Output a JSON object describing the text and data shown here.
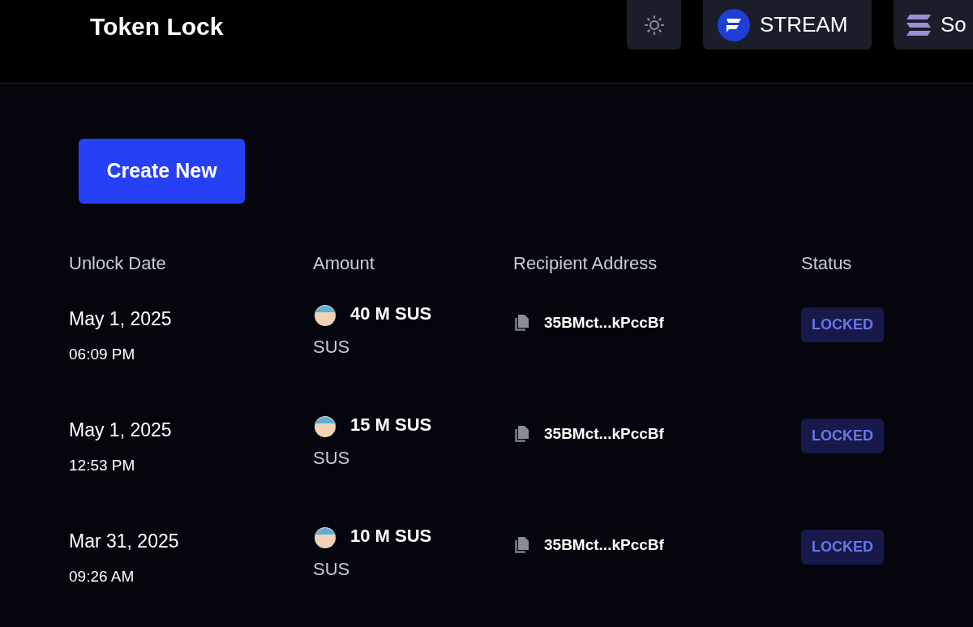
{
  "header": {
    "title": "Token Lock",
    "buttons": [
      {
        "kind": "theme"
      },
      {
        "kind": "stream",
        "label": "STREAM"
      },
      {
        "kind": "solana",
        "label": "So"
      }
    ]
  },
  "create_button": "Create New",
  "table": {
    "columns": [
      "Unlock Date",
      "Amount",
      "Recipient Address",
      "Status"
    ],
    "rows": [
      {
        "date": "May 1, 2025",
        "time": "06:09 PM",
        "amount": "40 M SUS",
        "token": "SUS",
        "address": "35BMct...kPccBf",
        "status": {
          "label": "LOCKED",
          "kind": "locked"
        }
      },
      {
        "date": "May 1, 2025",
        "time": "12:53 PM",
        "amount": "15 M SUS",
        "token": "SUS",
        "address": "35BMct...kPccBf",
        "status": {
          "label": "LOCKED",
          "kind": "locked"
        }
      },
      {
        "date": "Mar 31, 2025",
        "time": "09:26 AM",
        "amount": "10 M SUS",
        "token": "SUS",
        "address": "35BMct...kPccBf",
        "status": {
          "label": "LOCKED",
          "kind": "locked"
        }
      }
    ]
  }
}
